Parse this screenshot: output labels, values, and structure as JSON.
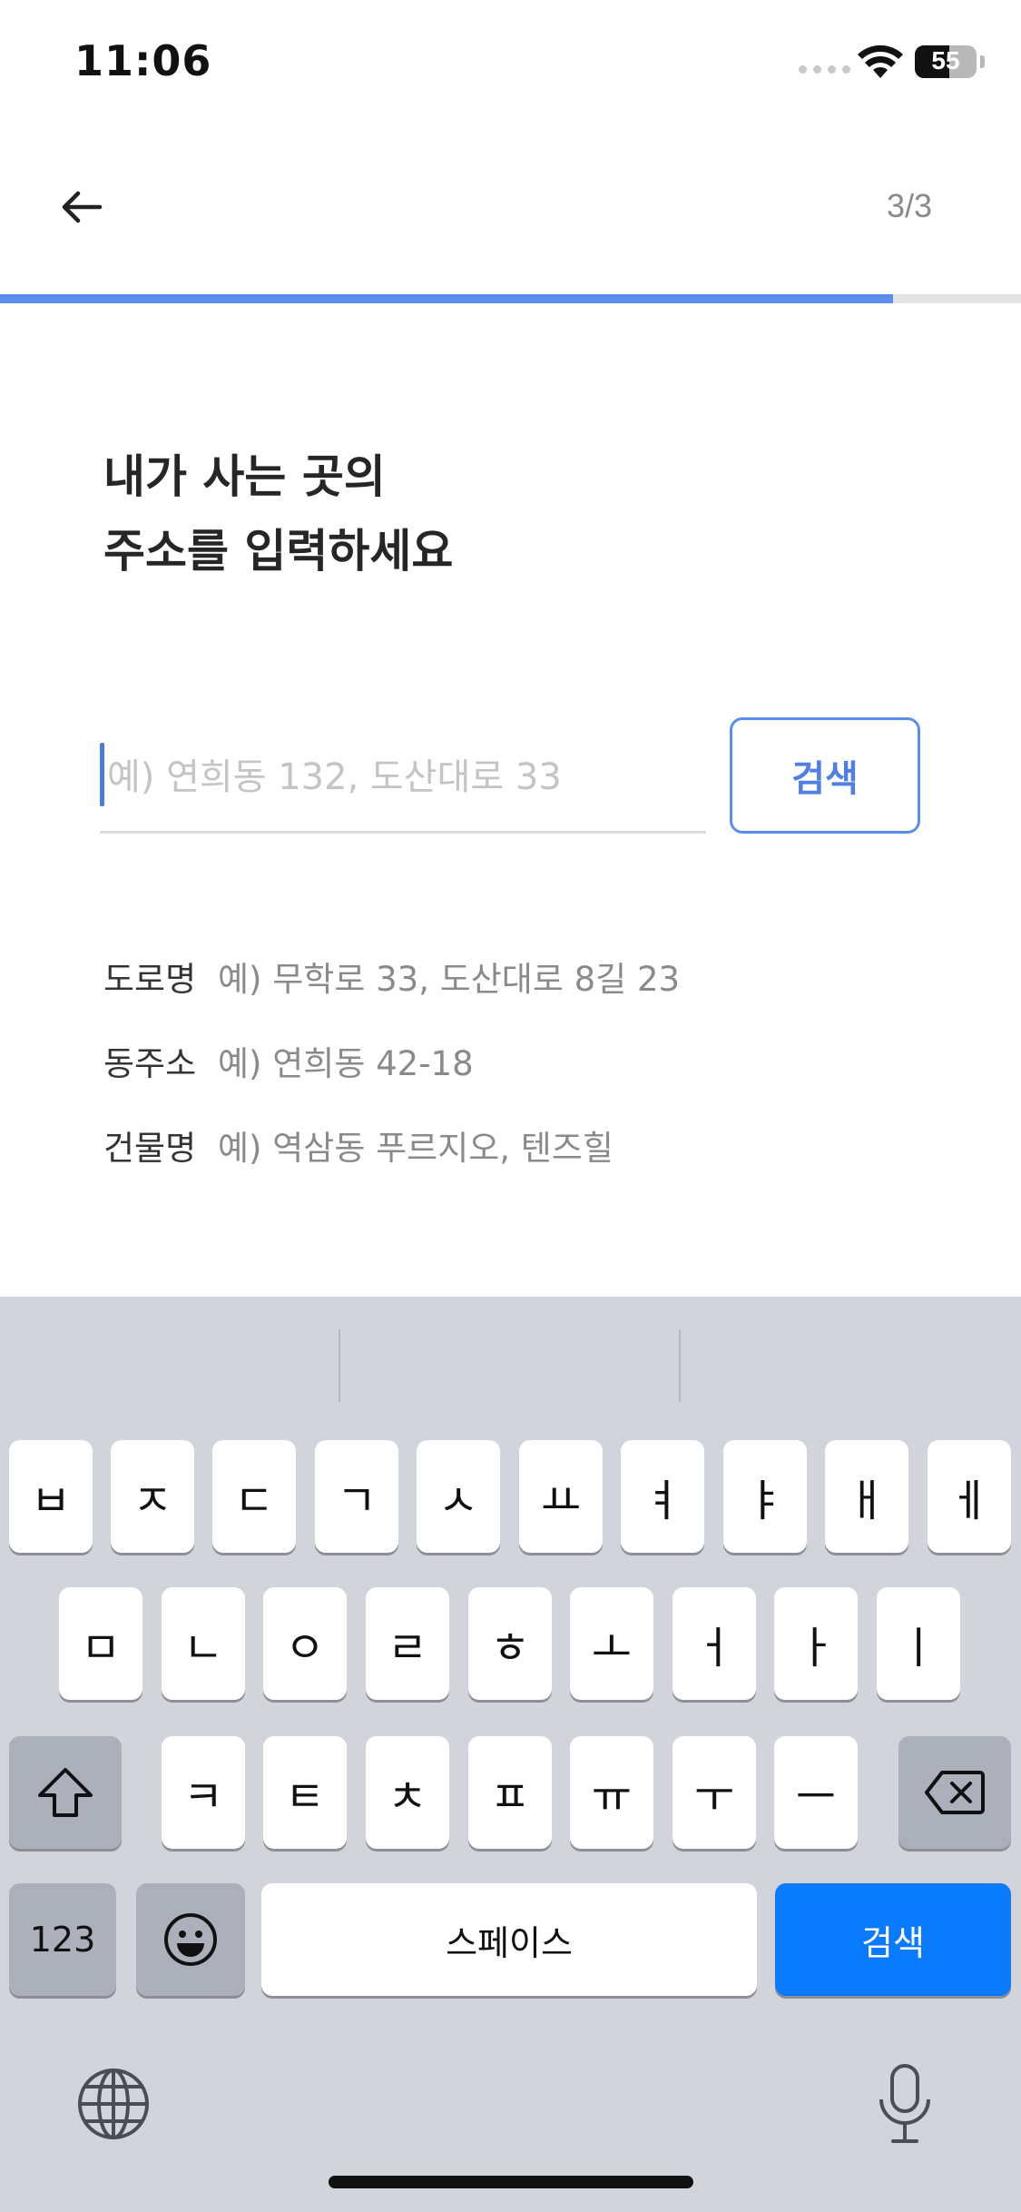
{
  "status_bar": {
    "time": "11:06",
    "battery": "55",
    "battery_level": 0.55
  },
  "header": {
    "back_icon": "arrow-left-icon",
    "step": "3/3"
  },
  "progress": {
    "value": 0.875,
    "color": "#5b8def"
  },
  "heading": {
    "line1": "내가 사는 곳의",
    "line2": "주소를 입력하세요"
  },
  "search": {
    "placeholder": "예) 연희동 132, 도산대로 33",
    "value": "",
    "button_label": "검색"
  },
  "examples": [
    {
      "label": "도로명",
      "value": "예) 무학로 33, 도산대로 8길 23"
    },
    {
      "label": "동주소",
      "value": "예) 연희동 42-18"
    },
    {
      "label": "건물명",
      "value": "예) 역삼동 푸르지오, 텐즈힐"
    }
  ],
  "keyboard": {
    "row1": [
      "ㅂ",
      "ㅈ",
      "ㄷ",
      "ㄱ",
      "ㅅ",
      "ㅛ",
      "ㅕ",
      "ㅑ",
      "ㅐ",
      "ㅔ"
    ],
    "row2": [
      "ㅁ",
      "ㄴ",
      "ㅇ",
      "ㄹ",
      "ㅎ",
      "ㅗ",
      "ㅓ",
      "ㅏ",
      "ㅣ"
    ],
    "row3": [
      "ㅋ",
      "ㅌ",
      "ㅊ",
      "ㅍ",
      "ㅠ",
      "ㅜ",
      "ㅡ"
    ],
    "numbers_label": "123",
    "space_label": "스페이스",
    "return_label": "검색",
    "shift_icon": "shift-icon",
    "delete_icon": "delete-icon",
    "emoji_icon": "emoji-icon",
    "globe_icon": "globe-icon",
    "mic_icon": "microphone-icon",
    "accent_color": "#0a7aff"
  }
}
